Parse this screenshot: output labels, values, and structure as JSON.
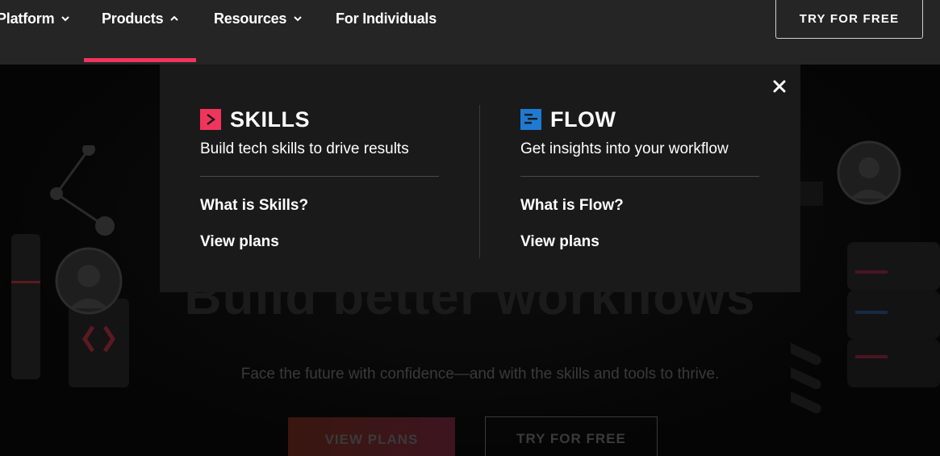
{
  "nav": {
    "items": [
      {
        "label": "Platform"
      },
      {
        "label": "Products"
      },
      {
        "label": "Resources"
      },
      {
        "label": "For Individuals"
      }
    ],
    "cta_label": "TRY FOR FREE"
  },
  "dropdown": {
    "products": [
      {
        "name": "SKILLS",
        "tagline": "Build tech skills to drive results",
        "links": [
          "What is Skills?",
          "View plans"
        ],
        "logo_color": "#f0355c"
      },
      {
        "name": "FLOW",
        "tagline": "Get insights into your workflow",
        "links": [
          "What is Flow?",
          "View plans"
        ],
        "logo_color": "#1f7ad1"
      }
    ]
  },
  "hero": {
    "title": "Build better workflows",
    "subtitle": "Face the future with confidence—and with the skills and tools to thrive.",
    "primary_button": "VIEW PLANS",
    "secondary_button": "TRY FOR FREE"
  },
  "colors": {
    "accent": "#f0355c",
    "nav_bg": "#252525",
    "dropdown_bg": "#1a1a1a"
  }
}
